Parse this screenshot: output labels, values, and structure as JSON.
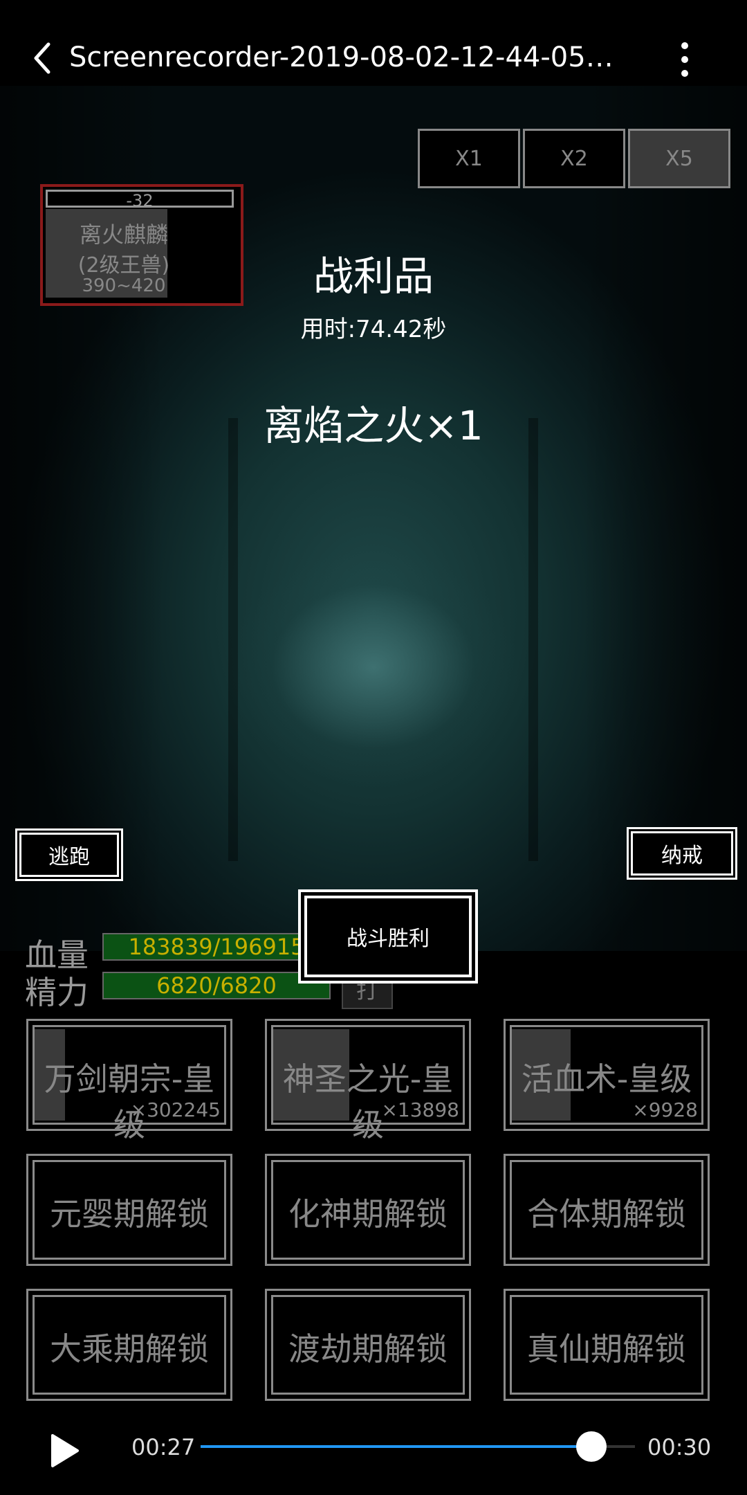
{
  "app": {
    "title": "Screenrecorder-2019-08-02-12-44-05-90..."
  },
  "speed": {
    "buttons": [
      "X1",
      "X2",
      "X5"
    ],
    "selected": "X5"
  },
  "monster": {
    "hp_delta": "-32",
    "name": "离火麒麟",
    "level": "(2级王兽)",
    "damage_range": "390~420",
    "remaining_hp_fraction": 0.78
  },
  "loot": {
    "title": "战利品",
    "time": "用时:74.42秒",
    "item": "离焰之火×1"
  },
  "scene_buttons": {
    "escape": "逃跑",
    "ring": "纳戒"
  },
  "victory": {
    "label": "战斗胜利"
  },
  "stats": {
    "hp_label": "血量",
    "hp_value": "183839/196915",
    "hp_fraction": 0.934,
    "energy_label": "精力",
    "energy_value": "6820/6820",
    "energy_fraction": 1.0,
    "eat_label": "打"
  },
  "skills": [
    {
      "name": "万剑朝宗-皇级",
      "count": "×302245",
      "cooldown_fraction": 0.16
    },
    {
      "name": "神圣之光-皇级",
      "count": "×13898",
      "cooldown_fraction": 0.4
    },
    {
      "name": "活血术-皇级",
      "count": "×9928",
      "cooldown_fraction": 0.31
    }
  ],
  "unlocks": [
    "元婴期解锁",
    "化神期解锁",
    "合体期解锁",
    "大乘期解锁",
    "渡劫期解锁",
    "真仙期解锁"
  ],
  "player": {
    "current_time": "00:27",
    "total_time": "00:30",
    "progress_fraction": 0.9
  },
  "colors": {
    "bar_fill": "#0b5214",
    "bar_text": "#c8b000",
    "progress": "#2196f3",
    "monster_border": "#8b1a1a"
  }
}
